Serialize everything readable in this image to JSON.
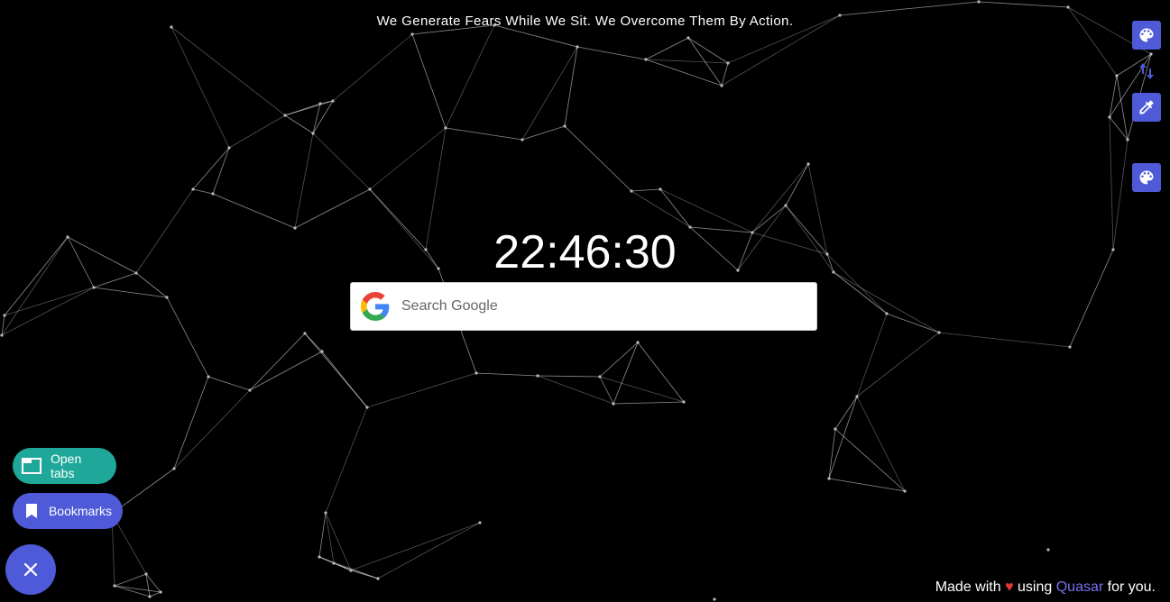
{
  "quote": "We Generate Fears While We Sit. We Overcome Them By Action.",
  "clock": "22:46:30",
  "search": {
    "placeholder": "Search Google",
    "icon": "google-g-icon"
  },
  "side_buttons": [
    {
      "icon": "palette-icon"
    },
    {
      "icon": "swap-vert-icon"
    },
    {
      "icon": "eyedropper-icon"
    },
    {
      "icon": "palette-icon"
    }
  ],
  "open_tabs": {
    "label": "Open tabs",
    "icon": "tab-icon",
    "color": "#1fa89a"
  },
  "bookmarks": {
    "label": "Bookmarks",
    "icon": "bookmark-icon",
    "color": "#4e5ad7"
  },
  "fab": {
    "icon": "close-icon",
    "color": "#4e5ad7"
  },
  "footer": {
    "made_with": "Made with",
    "heart": "♥",
    "using": "using",
    "framework": "Quasar",
    "for_you": "for you."
  },
  "colors": {
    "accent": "#4e5ad7",
    "teal": "#1fa89a",
    "heart": "#e53935",
    "link": "#7a6ff0",
    "background": "#000000"
  }
}
